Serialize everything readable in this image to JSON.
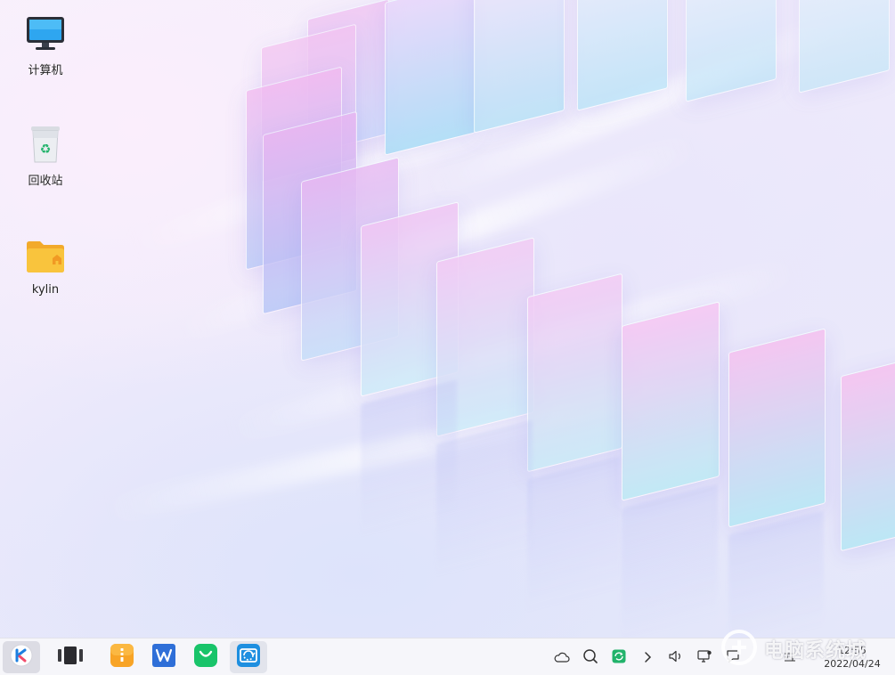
{
  "desktop": {
    "icons": [
      {
        "label": "计算机",
        "icon": "computer-icon"
      },
      {
        "label": "回收站",
        "icon": "trash-icon"
      },
      {
        "label": "kylin",
        "icon": "home-folder-icon"
      }
    ]
  },
  "taskbar": {
    "start": {
      "icon": "kylin-start-icon"
    },
    "apps": [
      {
        "icon": "multitask-view-icon"
      },
      {
        "icon": "file-manager-icon"
      },
      {
        "icon": "wps-office-icon"
      },
      {
        "icon": "software-store-icon"
      },
      {
        "icon": "browser-icon"
      }
    ],
    "tray": [
      {
        "icon": "weather-cloud-icon"
      },
      {
        "icon": "search-icon"
      },
      {
        "icon": "sync-icon"
      },
      {
        "icon": "chevron-right-icon"
      },
      {
        "icon": "volume-icon"
      },
      {
        "icon": "network-icon"
      },
      {
        "icon": "notification-icon"
      },
      {
        "icon": "keyboard-icon"
      }
    ],
    "clock": {
      "time": "12:55",
      "date": "2022/04/24"
    }
  },
  "watermark": {
    "text": "电脑系统城"
  },
  "colors": {
    "folder": "#f7c23c",
    "wps": "#2f6fd8",
    "store": "#19c46a",
    "files": "#f8a426",
    "browser": "#1e8fe0"
  }
}
